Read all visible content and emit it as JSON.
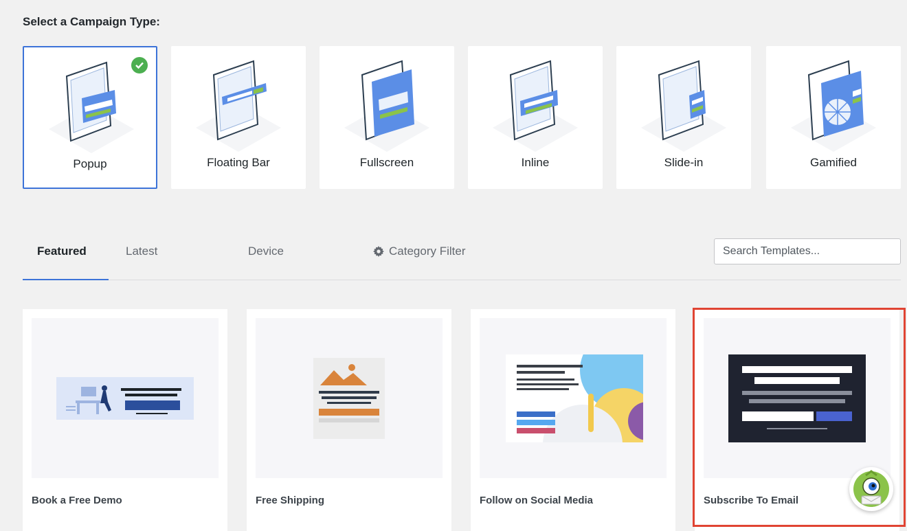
{
  "header": {
    "title": "Select a Campaign Type:"
  },
  "campaign_types": [
    {
      "label": "Popup",
      "selected": true
    },
    {
      "label": "Floating Bar",
      "selected": false
    },
    {
      "label": "Fullscreen",
      "selected": false
    },
    {
      "label": "Inline",
      "selected": false
    },
    {
      "label": "Slide-in",
      "selected": false
    },
    {
      "label": "Gamified",
      "selected": false
    }
  ],
  "tabs": [
    {
      "label": "Featured",
      "active": true
    },
    {
      "label": "Latest",
      "active": false
    },
    {
      "label": "Device",
      "active": false
    }
  ],
  "filter": {
    "label": "Category Filter",
    "icon": "gear-icon"
  },
  "search": {
    "placeholder": "Search Templates..."
  },
  "templates": [
    {
      "label": "Book a Free Demo"
    },
    {
      "label": "Free Shipping"
    },
    {
      "label": "Follow on Social Media"
    },
    {
      "label": "Subscribe To Email"
    }
  ],
  "colors": {
    "accent": "#3c73d8",
    "success": "#4caf50",
    "highlight": "#e04433",
    "illustration_blue": "#5b8ee6",
    "illustration_green": "#8bc34a"
  }
}
